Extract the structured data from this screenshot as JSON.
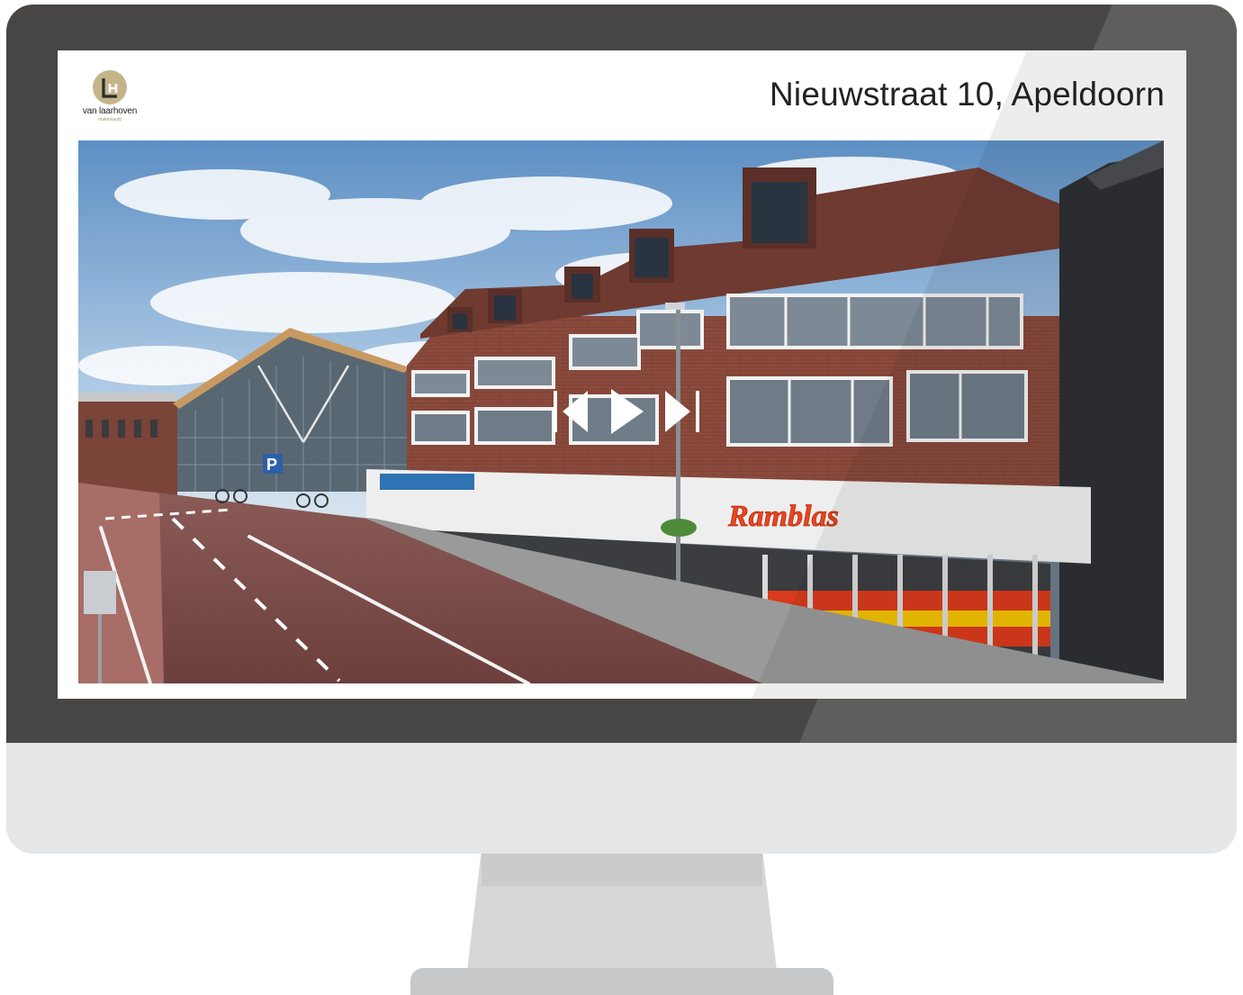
{
  "brand": {
    "name": "van laarhoven",
    "tagline": "makelaardij",
    "accent": "#c5b48a"
  },
  "listing": {
    "address": "Nieuwstraat 10, Apeldoorn"
  },
  "photo": {
    "storefront_sign": "Ramblas",
    "parking_sign": "P"
  },
  "controls": {
    "previous_icon": "skip-previous-icon",
    "play_icon": "play-icon",
    "next_icon": "skip-next-icon"
  }
}
